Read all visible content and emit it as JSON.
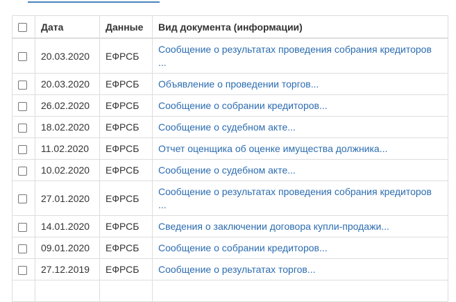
{
  "table": {
    "headers": {
      "date": "Дата",
      "source": "Данные",
      "type": "Вид документа (информации)"
    },
    "rows": [
      {
        "date": "20.03.2020",
        "source": "ЕФРСБ",
        "type_line1": "Сообщение о результатах проведения собрания кредиторов",
        "type_line2": "..."
      },
      {
        "date": "20.03.2020",
        "source": "ЕФРСБ",
        "type_line1": "Объявление о проведении торгов...",
        "type_line2": ""
      },
      {
        "date": "26.02.2020",
        "source": "ЕФРСБ",
        "type_line1": "Сообщение о собрании кредиторов...",
        "type_line2": ""
      },
      {
        "date": "18.02.2020",
        "source": "ЕФРСБ",
        "type_line1": "Сообщение о судебном акте...",
        "type_line2": ""
      },
      {
        "date": "11.02.2020",
        "source": "ЕФРСБ",
        "type_line1": "Отчет оценщика об оценке имущества должника...",
        "type_line2": ""
      },
      {
        "date": "10.02.2020",
        "source": "ЕФРСБ",
        "type_line1": "Сообщение о судебном акте...",
        "type_line2": ""
      },
      {
        "date": "27.01.2020",
        "source": "ЕФРСБ",
        "type_line1": "Сообщение о результатах проведения собрания кредиторов",
        "type_line2": "..."
      },
      {
        "date": "14.01.2020",
        "source": "ЕФРСБ",
        "type_line1": "Сведения о заключении договора купли-продажи...",
        "type_line2": ""
      },
      {
        "date": "09.01.2020",
        "source": "ЕФРСБ",
        "type_line1": "Сообщение о собрании кредиторов...",
        "type_line2": ""
      },
      {
        "date": "27.12.2019",
        "source": "ЕФРСБ",
        "type_line1": "Сообщение о результатах торгов...",
        "type_line2": ""
      }
    ]
  },
  "colors": {
    "link": "#2b6cb0",
    "border": "#dddddd",
    "text": "#333333"
  }
}
